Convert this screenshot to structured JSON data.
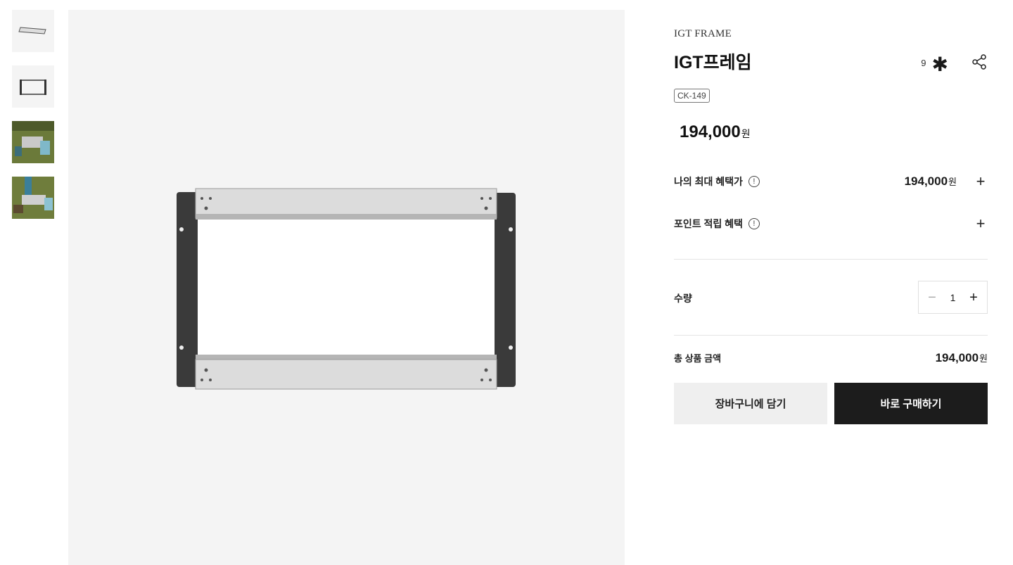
{
  "gallery": {
    "thumbnails": [
      {
        "alt": "frame-top-view"
      },
      {
        "alt": "frame-front-view"
      },
      {
        "alt": "camping-scene-1"
      },
      {
        "alt": "camping-scene-2"
      }
    ]
  },
  "product": {
    "brand": "IGT FRAME",
    "title": "IGT프레임",
    "code": "CK-149",
    "price": "194,000",
    "currency": "원",
    "wish_count": "9",
    "wish_icon": "✱"
  },
  "benefits": {
    "max_benefit_label": "나의 최대 혜택가",
    "max_benefit_value": "194,000",
    "points_label": "포인트 적립 혜택",
    "info_glyph": "!",
    "plus_glyph": "+"
  },
  "quantity": {
    "label": "수량",
    "value": "1",
    "minus_glyph": "−",
    "plus_glyph": "+"
  },
  "total": {
    "label": "총 상품 금액",
    "value": "194,000"
  },
  "actions": {
    "cart_label": "장바구니에 담기",
    "buy_label": "바로 구매하기"
  },
  "colors": {
    "buy_button": "#1c1c1c",
    "cart_button": "#efefef",
    "image_bg": "#f4f4f4"
  }
}
